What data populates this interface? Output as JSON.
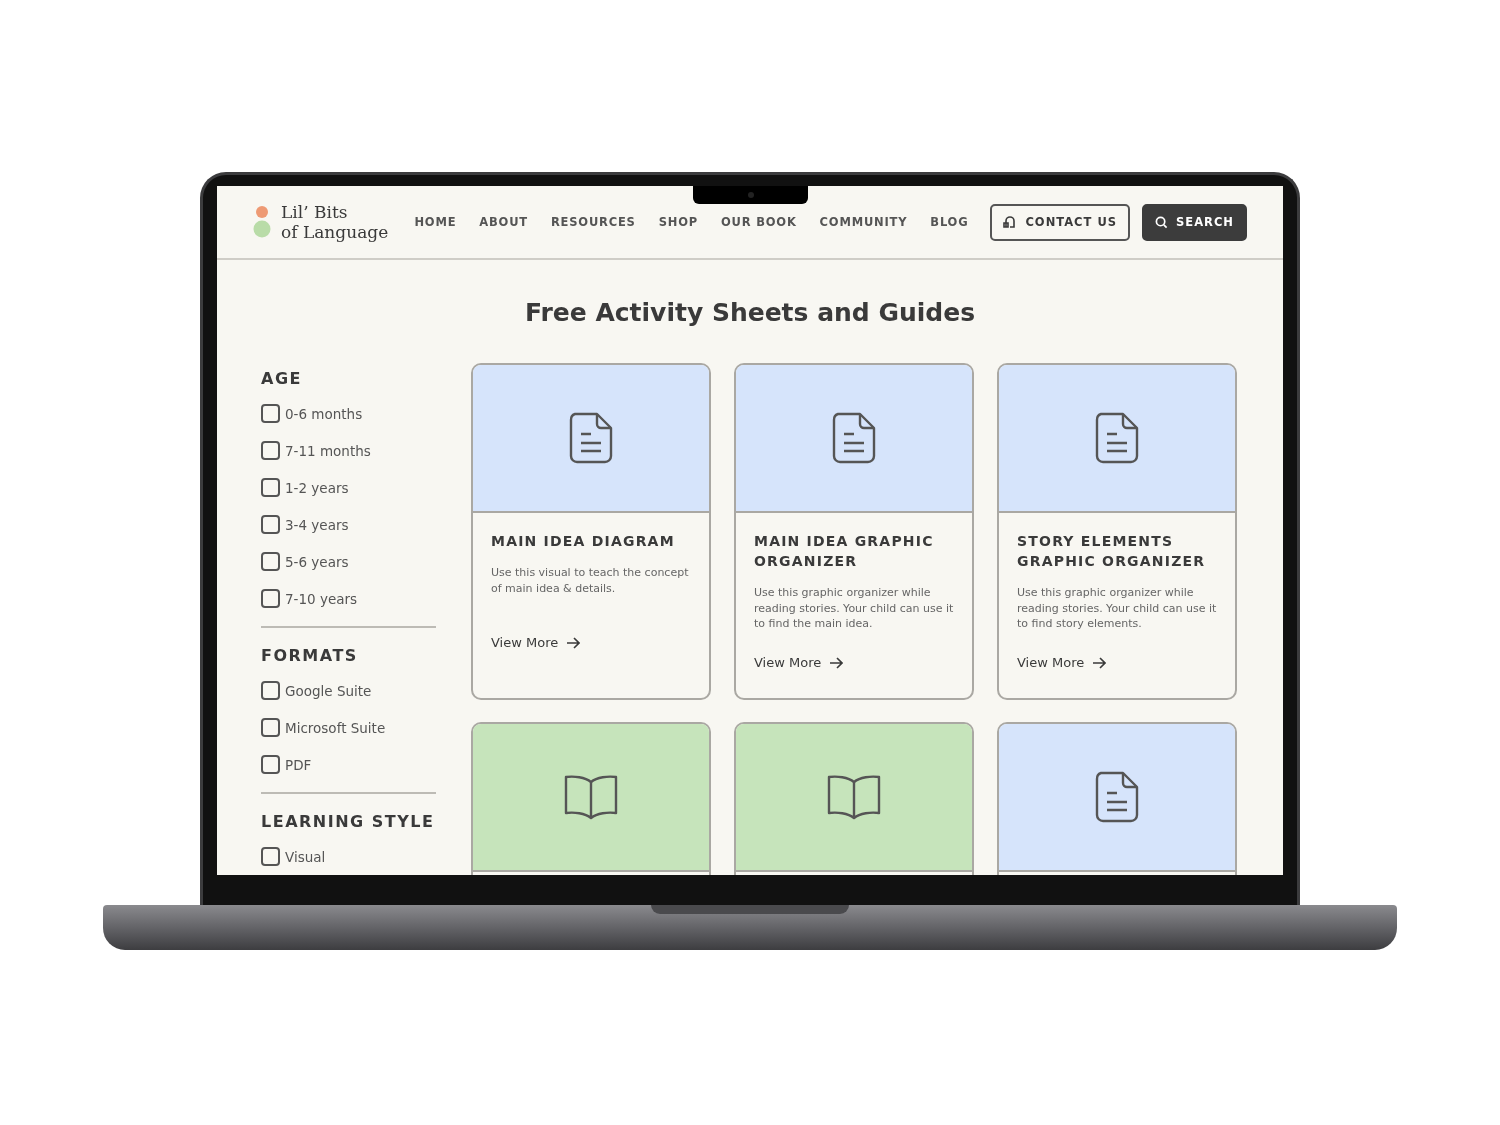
{
  "logo": {
    "lines": [
      "Lil’ Bits",
      "of Language"
    ]
  },
  "nav": [
    "HOME",
    "ABOUT",
    "RESOURCES",
    "SHOP",
    "OUR BOOK",
    "COMMUNITY",
    "BLOG"
  ],
  "contact_button": "CONTACT US",
  "search_button": "SEARCH",
  "page_title": "Free Activity Sheets and Guides",
  "filters": [
    {
      "heading": "AGE",
      "options": [
        {
          "label": "0-6 months",
          "checked": false
        },
        {
          "label": "7-11 months",
          "checked": false
        },
        {
          "label": "1-2 years",
          "checked": false
        },
        {
          "label": "3-4 years",
          "checked": false
        },
        {
          "label": "5-6 years",
          "checked": false
        },
        {
          "label": "7-10 years",
          "checked": false
        }
      ]
    },
    {
      "heading": "FORMATS",
      "options": [
        {
          "label": "Google Suite",
          "checked": false
        },
        {
          "label": "Microsoft Suite",
          "checked": false
        },
        {
          "label": "PDF",
          "checked": false
        }
      ]
    },
    {
      "heading": "LEARNING STYLE",
      "options": [
        {
          "label": "Visual",
          "checked": false
        }
      ]
    }
  ],
  "cards": [
    {
      "kind": "document",
      "title": "MAIN IDEA DIAGRAM",
      "description": "Use this visual to teach the concept of main idea & details.",
      "link": "View More"
    },
    {
      "kind": "document",
      "title": "MAIN IDEA GRAPHIC ORGANIZER",
      "description": "Use this graphic organizer while reading stories. Your child can use it to find the main idea.",
      "link": "View More"
    },
    {
      "kind": "document",
      "title": "STORY ELEMENTS GRAPHIC ORGANIZER",
      "description": "Use this graphic organizer while reading stories. Your child can use it to find story elements.",
      "link": "View More"
    },
    {
      "kind": "book"
    },
    {
      "kind": "book"
    },
    {
      "kind": "document"
    }
  ]
}
